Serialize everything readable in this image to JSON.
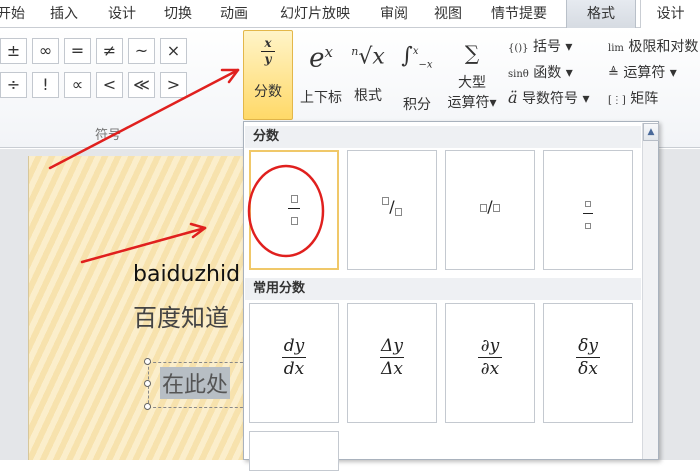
{
  "tabs": [
    {
      "label": "开始"
    },
    {
      "label": "插入"
    },
    {
      "label": "设计"
    },
    {
      "label": "切换"
    },
    {
      "label": "动画"
    },
    {
      "label": "幻灯片放映"
    },
    {
      "label": "审阅"
    },
    {
      "label": "视图"
    },
    {
      "label": "情节提要"
    },
    {
      "label": "格式"
    },
    {
      "label": "设计"
    }
  ],
  "symbols": {
    "row1": [
      "±",
      "∞",
      "=",
      "≠",
      "~",
      "×"
    ],
    "row2": [
      "÷",
      "!",
      "∝",
      "<",
      "≪",
      ">"
    ],
    "group_label": "符号"
  },
  "ribbon": {
    "fraction": {
      "icon_top": "x",
      "icon_bottom": "y",
      "label": "分数"
    },
    "script": {
      "label": "上下标"
    },
    "radical": {
      "label": "根式"
    },
    "integral": {
      "label": "积分"
    },
    "largeop": {
      "label1": "大型",
      "label2": "运算符"
    },
    "bracket": {
      "label": "括号"
    },
    "function": {
      "label": "函数"
    },
    "accent": {
      "label": "导数符号"
    },
    "limit": {
      "label": "极限和对数"
    },
    "operator": {
      "label": "运算符"
    },
    "matrix": {
      "label": "矩阵"
    }
  },
  "slide": {
    "title": "baiduzhid",
    "subtitle": "百度知道",
    "textbox": "在此处"
  },
  "dropdown": {
    "section1": "分数",
    "section2": "常用分数",
    "common": [
      {
        "num": "dy",
        "den": "dx"
      },
      {
        "num": "Δy",
        "den": "Δx"
      },
      {
        "num": "∂y",
        "den": "∂x"
      },
      {
        "num": "δy",
        "den": "δx"
      }
    ]
  },
  "accent_color": "#f0c869",
  "annotation_color": "#e0201e"
}
